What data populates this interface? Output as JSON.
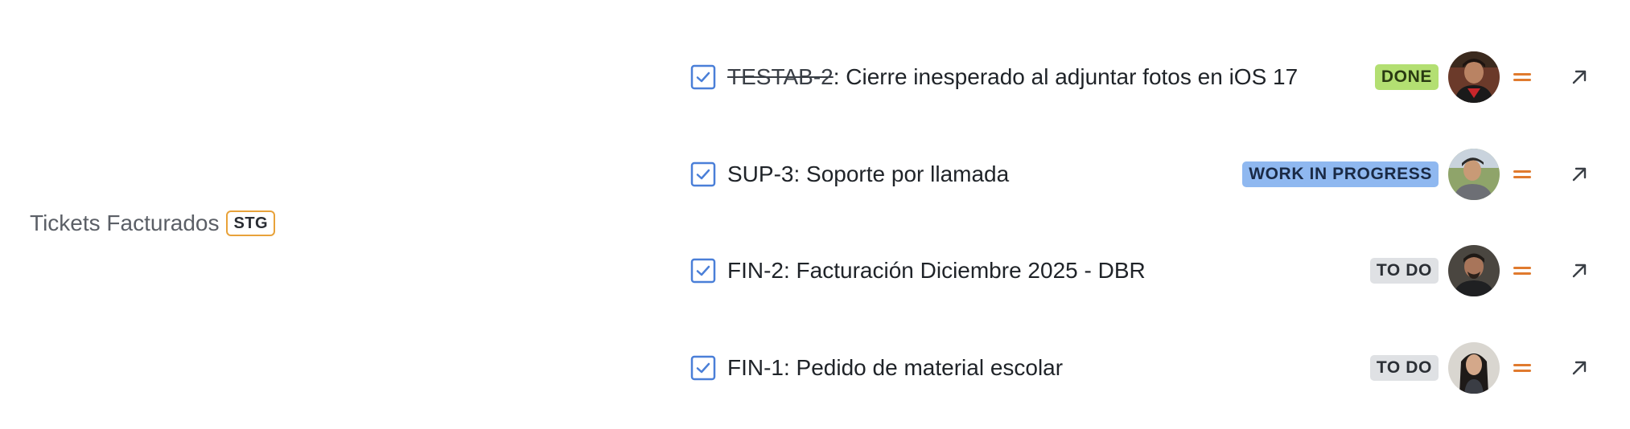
{
  "section": {
    "title": "Tickets Facturados",
    "env_badge": "STG"
  },
  "tickets": [
    {
      "key": "TESTAB-2",
      "title": ": Cierre inesperado al adjuntar fotos en iOS 17",
      "status": "DONE",
      "status_color": "#b3df72",
      "resolved": true,
      "priority_icon": "priority-medium-icon",
      "open_icon": "arrow-up-right-icon"
    },
    {
      "key": "SUP-3",
      "title": ": Soporte por llamada",
      "status": "WORK IN PROGRESS",
      "status_color": "#8fb8f0",
      "resolved": false,
      "priority_icon": "priority-medium-icon",
      "open_icon": "arrow-up-right-icon"
    },
    {
      "key": "FIN-2",
      "title": ": Facturación Diciembre 2025 - DBR",
      "status": "TO DO",
      "status_color": "#dfe1e4",
      "resolved": false,
      "priority_icon": "priority-medium-icon",
      "open_icon": "arrow-up-right-icon"
    },
    {
      "key": "FIN-1",
      "title": ": Pedido de material escolar",
      "status": "TO DO",
      "status_color": "#dfe1e4",
      "resolved": false,
      "priority_icon": "priority-medium-icon",
      "open_icon": "arrow-up-right-icon"
    }
  ],
  "colors": {
    "task_icon": "#4a7fd8",
    "priority": "#e07a2e",
    "env_badge_border": "#e8a23a"
  }
}
